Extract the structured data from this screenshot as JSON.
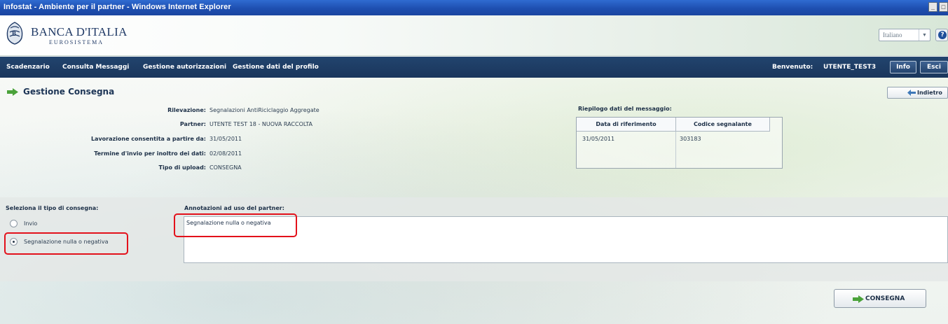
{
  "window": {
    "title": "Infostat - Ambiente per il partner - Windows Internet Explorer",
    "minimize": "_",
    "maximize": "□"
  },
  "header": {
    "bank_name": "BANCA D'ITALIA",
    "bank_sub": "EUROSISTEMA",
    "language": "Italiano",
    "help": "?"
  },
  "nav": {
    "items": [
      "Scadenzario",
      "Consulta Messaggi",
      "Gestione autorizzazioni",
      "Gestione dati del profilo"
    ],
    "welcome_label": "Benvenuto:",
    "user": "UTENTE_TEST3",
    "info": "Info",
    "exit": "Esci"
  },
  "page": {
    "title": "Gestione Consegna",
    "back": "Indietro"
  },
  "details": {
    "rilevazione_label": "Rilevazione:",
    "rilevazione_value": "Segnalazioni AntiRiciclaggio Aggregate",
    "partner_label": "Partner:",
    "partner_value": "UTENTE TEST 18 - NUOVA RACCOLTA",
    "lavorazione_label": "Lavorazione consentita a partire da:",
    "lavorazione_value": "31/05/2011",
    "termine_label": "Termine d'invio per inoltro dei dati:",
    "termine_value": "02/08/2011",
    "tipo_label": "Tipo di upload:",
    "tipo_value": "CONSEGNA"
  },
  "summary": {
    "title": "Riepilogo dati del messaggio:",
    "columns": [
      "Data di riferimento",
      "Codice segnalante"
    ],
    "row": [
      "31/05/2011",
      "303183"
    ]
  },
  "delivery": {
    "title": "Seleziona il tipo di consegna:",
    "options": [
      "Invio",
      "Segnalazione nulla o negativa"
    ],
    "selected": "Segnalazione nulla o negativa"
  },
  "annotations": {
    "title": "Annotazioni ad uso del partner:",
    "value": "Segnalazione nulla o negativa"
  },
  "actions": {
    "consegna": "CONSEGNA"
  },
  "colors": {
    "navbar": "#1a365c",
    "titlebar": "#1e4fb0",
    "highlight": "#e3111b",
    "arrow_green": "#4aa23a"
  }
}
